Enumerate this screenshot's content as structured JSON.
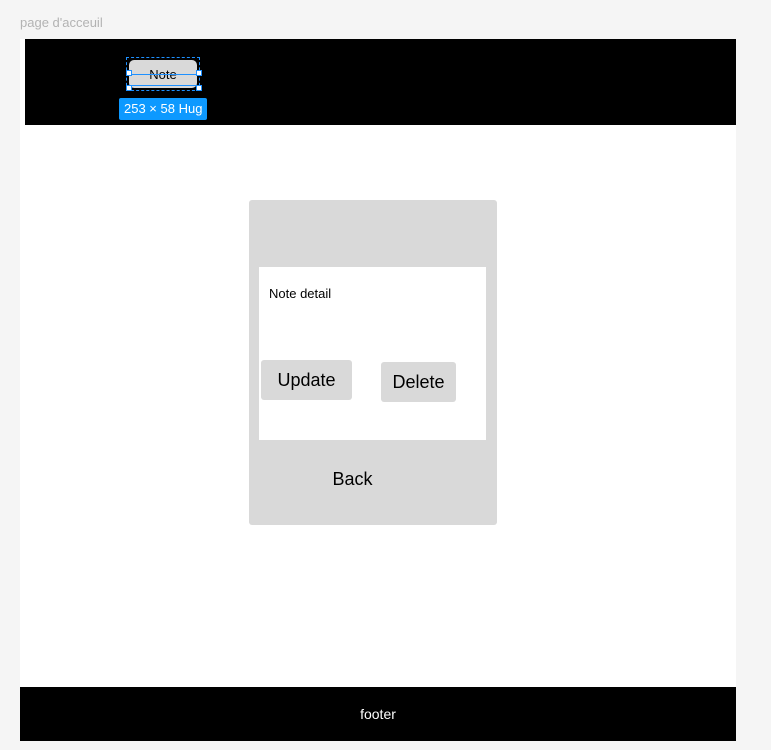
{
  "frame": {
    "label": "page d'acceuil"
  },
  "header": {
    "note_button_label": "Note",
    "selection_size_label": "253 × 58 Hug"
  },
  "card": {
    "detail_label": "Note detail",
    "update_label": "Update",
    "delete_label": "Delete",
    "back_label": "Back"
  },
  "footer": {
    "label": "footer"
  },
  "colors": {
    "header_bg": "#000000",
    "footer_bg": "#000000",
    "card_bg": "#d9d9d9",
    "selection_accent": "#0d99ff"
  }
}
